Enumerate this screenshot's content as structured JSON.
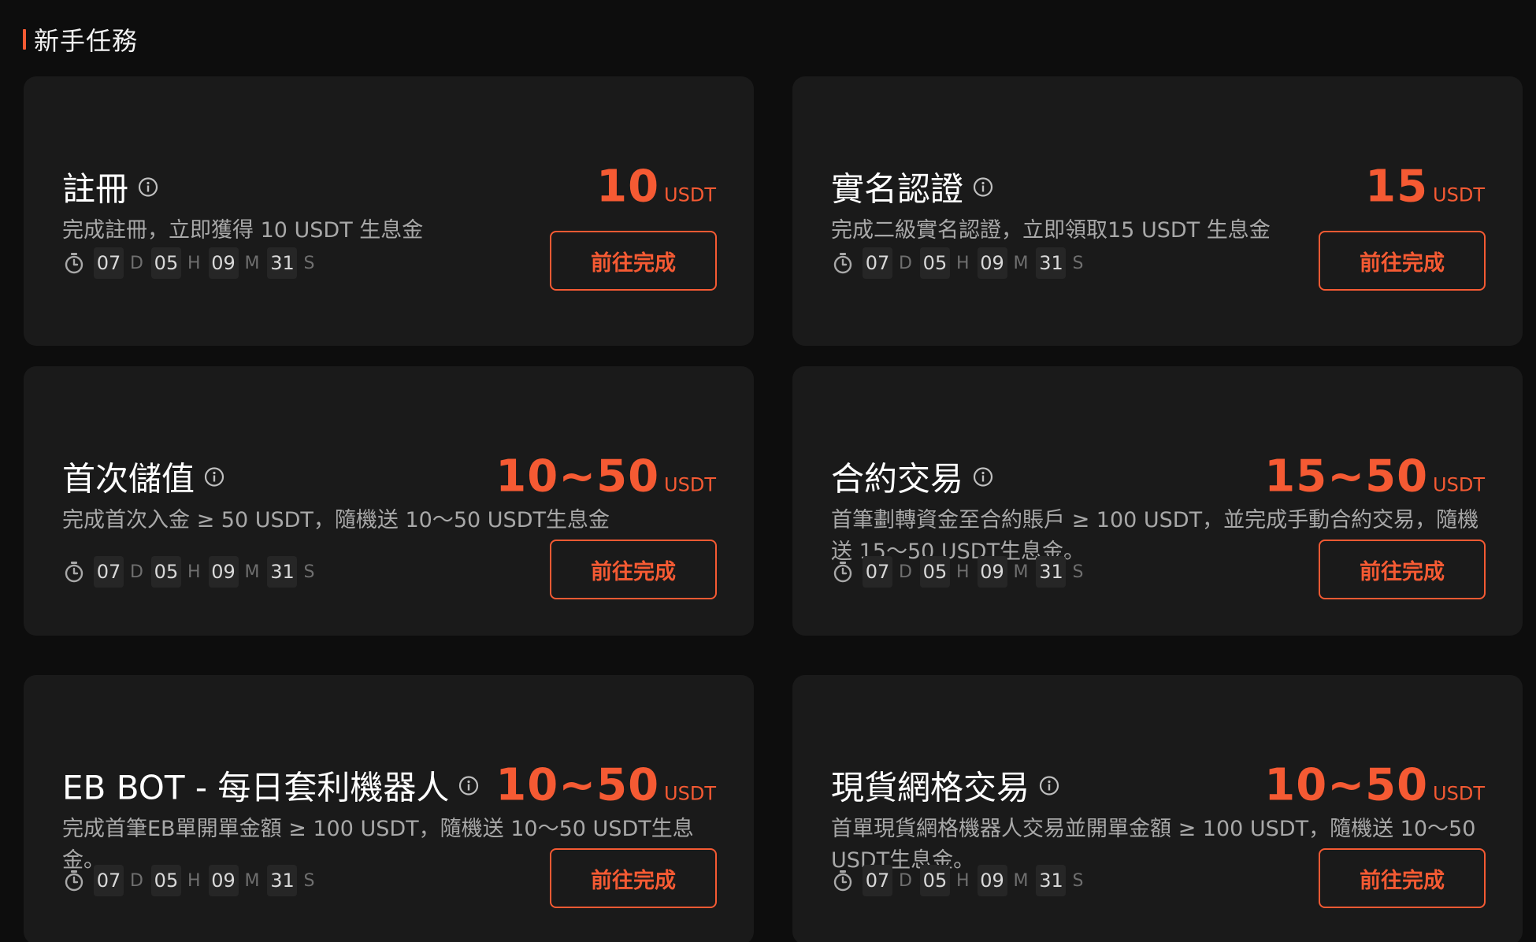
{
  "section": {
    "title": "新手任務"
  },
  "theme": {
    "accent": "#f55a33",
    "card_bg": "#1a1a1a",
    "page_bg": "#0d0d0d"
  },
  "countdown": {
    "days": "07",
    "days_unit": "D",
    "hours": "05",
    "hours_unit": "H",
    "minutes": "09",
    "minutes_unit": "M",
    "seconds": "31",
    "seconds_unit": "S"
  },
  "tasks": [
    {
      "title": "註冊",
      "amount": "10",
      "unit": "USDT",
      "description": "完成註冊，立即獲得 10 USDT 生息金",
      "button": "前往完成"
    },
    {
      "title": "實名認證",
      "amount": "15",
      "unit": "USDT",
      "description": "完成二級實名認證，立即領取15 USDT 生息金",
      "button": "前往完成"
    },
    {
      "title": "首次儲值",
      "amount": "10~50",
      "unit": "USDT",
      "description": "完成首次入金 ≥ 50 USDT，隨機送 10～50 USDT生息金",
      "button": "前往完成"
    },
    {
      "title": "合約交易",
      "amount": "15~50",
      "unit": "USDT",
      "description": "首筆劃轉資金至合約賬戶 ≥ 100 USDT，並完成手動合約交易，隨機送 15～50 USDT生息金。",
      "button": "前往完成"
    },
    {
      "title": "EB BOT - 每日套利機器人",
      "amount": "10~50",
      "unit": "USDT",
      "description": "完成首筆EB單開單金額 ≥ 100 USDT，隨機送 10～50 USDT生息金。",
      "button": "前往完成"
    },
    {
      "title": "現貨網格交易",
      "amount": "10~50",
      "unit": "USDT",
      "description": "首單現貨網格機器人交易並開單金額 ≥ 100 USDT，隨機送 10～50 USDT生息金。",
      "button": "前往完成"
    }
  ]
}
